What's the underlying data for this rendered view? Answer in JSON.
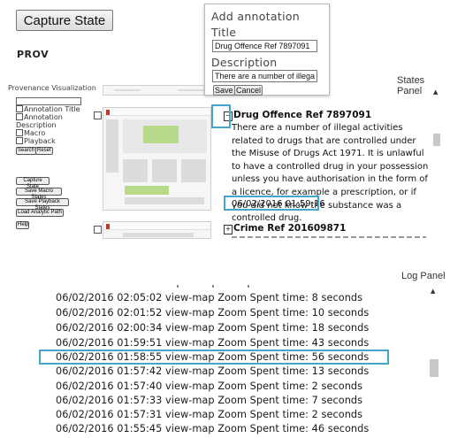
{
  "toolbar": {
    "capture_state": "Capture State"
  },
  "header": {
    "prov": "PROV"
  },
  "sidebar": {
    "title": "Provenance Visualization",
    "checkboxes": [
      "Annotation Title",
      "Annotation",
      "Description",
      "Macro",
      "Playback"
    ],
    "search": "Search",
    "reset": "Reset",
    "buttons": [
      "Capture State",
      "Save Macro States",
      "Save Playback States",
      "Load Analytic Path",
      "Help"
    ]
  },
  "annotation_popup": {
    "heading": "Add annotation",
    "title_label": "Title",
    "title_value": "Drug Offence Ref 7897091",
    "description_label": "Description",
    "description_value": "There are a number of illegal",
    "save": "Save",
    "cancel": "Cancel"
  },
  "states_panel": {
    "label": "States Panel",
    "states": [
      {
        "title": "Drug Offence Ref 7897091",
        "description": "There are a number of illegal activities related to drugs that are controlled under the Misuse of Drugs Act 1971. It is unlawful to have a controlled drug in your possession unless you have authorisation in the form of a licence, for example a prescription, or if you did not know the substance was a controlled drug.",
        "timestamp": "06/02/2016 01:59:16"
      },
      {
        "title": "Crime Ref 201609871"
      }
    ]
  },
  "log_panel": {
    "label": "Log Panel",
    "entries": [
      "06/02/2016 02:05:02 view-map Zoom Spent time: 8 seconds",
      "06/02/2016 02:01:52 view-map Zoom Spent time: 10 seconds",
      "06/02/2016 02:00:34 view-map Zoom Spent time: 18 seconds",
      "06/02/2016 01:59:51 view-map Zoom Spent time: 43 seconds",
      "06/02/2016 01:58:55 view-map Zoom Spent time: 56 seconds",
      "06/02/2016 01:57:42 view-map Zoom Spent time: 13 seconds",
      "06/02/2016 01:57:40 view-map Zoom Spent time: 2 seconds",
      "06/02/2016 01:57:33 view-map Zoom Spent time: 7 seconds",
      "06/02/2016 01:57:31 view-map Zoom Spent time: 2 seconds",
      "06/02/2016 01:55:45 view-map Zoom Spent time: 46 seconds"
    ]
  },
  "colors": {
    "highlight": "#46a6c9",
    "thumbnail_accent": "#c0392b"
  },
  "icons": {
    "collapse": "collapse-minus-icon",
    "expand": "expand-plus-icon",
    "scroll_up": "scroll-up-arrow-icon"
  }
}
